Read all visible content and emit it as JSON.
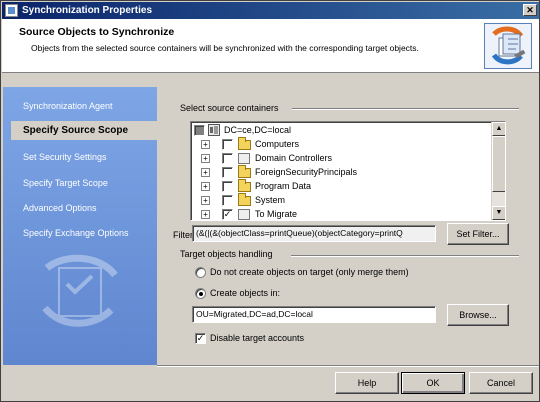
{
  "window": {
    "title": "Synchronization Properties",
    "close_label": "✕"
  },
  "header": {
    "title": "Source Objects to Synchronize",
    "description": "Objects from the selected source containers will be synchronized with the corresponding target objects."
  },
  "sidebar": {
    "items": [
      {
        "label": "Synchronization Agent"
      },
      {
        "label": "Specify Source Scope"
      },
      {
        "label": "Set Security Settings"
      },
      {
        "label": "Specify Target Scope"
      },
      {
        "label": "Advanced Options"
      },
      {
        "label": "Specify Exchange Options"
      }
    ]
  },
  "source": {
    "section_label": "Select source containers",
    "root": "DC=ce,DC=local",
    "children": [
      {
        "label": "Computers"
      },
      {
        "label": "Domain Controllers"
      },
      {
        "label": "ForeignSecurityPrincipals"
      },
      {
        "label": "Program Data"
      },
      {
        "label": "System"
      },
      {
        "label": "To Migrate"
      }
    ],
    "filter_label": "Filter:",
    "filter_value": "(&(|(&(objectClass=printQueue)(objectCategory=printQ",
    "set_filter_button": "Set Filter..."
  },
  "target": {
    "section_label": "Target objects handling",
    "option_no_create": "Do not create objects on target (only merge them)",
    "option_create": "Create objects in:",
    "create_in_value": "OU=Migrated,DC=ad,DC=local",
    "browse_button": "Browse...",
    "disable_accounts_label": "Disable target accounts"
  },
  "buttons": {
    "help": "Help",
    "ok": "OK",
    "cancel": "Cancel"
  }
}
